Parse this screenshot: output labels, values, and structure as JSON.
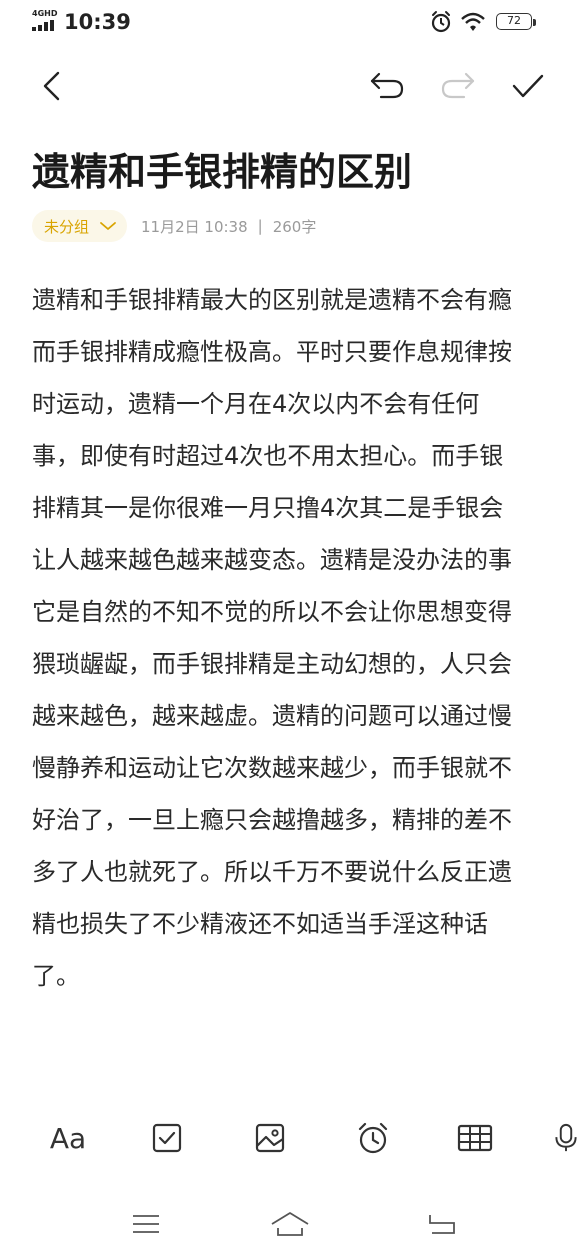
{
  "status_bar": {
    "network_label": "4GHD",
    "time": "10:39",
    "battery": "72",
    "icons": [
      "signal-icon",
      "alarm-icon",
      "wifi-icon",
      "battery-icon"
    ]
  },
  "toolbar": {
    "icons": [
      "back-arrow-icon",
      "undo-icon",
      "redo-icon",
      "checkmark-icon"
    ]
  },
  "note": {
    "title": "遗精和手银排精的区别",
    "group_label": "未分组",
    "date": "11月2日 10:38",
    "separator": "|",
    "word_count": "260字",
    "body_lines": [
      "遗精和手银排精最大的区别就是遗精不会有瘾",
      "而手银排精成瘾性极高。平时只要作息规律按",
      "时运动，遗精一个月在4次以内不会有任何",
      "事，即使有时超过4次也不用太担心。而手银",
      "排精其一是你很难一月只撸4次其二是手银会",
      "让人越来越色越来越变态。遗精是没办法的事",
      "它是自然的不知不觉的所以不会让你思想变得",
      "猥琐龌龊，而手银排精是主动幻想的，人只会",
      "越来越色，越来越虚。遗精的问题可以通过慢",
      "慢静养和运动让它次数越来越少，而手银就不",
      "好治了，一旦上瘾只会越撸越多，精排的差不",
      "多了人也就死了。所以千万不要说什么反正遗",
      "精也损失了不少精液还不如适当手淫这种话",
      "了。"
    ]
  },
  "format_bar": {
    "font_label": "Aa",
    "icons": [
      "text-format-icon",
      "checkbox-icon",
      "image-icon",
      "alarm-clock-icon",
      "table-icon",
      "microphone-icon"
    ]
  },
  "nav_bar": {
    "icons": [
      "menu-icon",
      "home-icon",
      "back-icon"
    ]
  },
  "colors": {
    "accent": "#d9a400",
    "chip_background": "#fbf7e8",
    "meta_gray": "#9a9a9a",
    "disabled_icon": "#c8c8c8"
  }
}
